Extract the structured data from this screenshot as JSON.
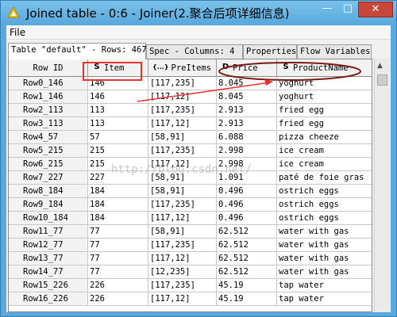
{
  "window": {
    "title": "Joined table - 0:6 - Joiner(2.聚合后项详细信息)"
  },
  "window_controls": {
    "minimize": "—",
    "maximize": "□",
    "close": "✕"
  },
  "menu": {
    "file": "File"
  },
  "tabs": [
    {
      "label": "Table \"default\" - Rows: 467",
      "active": true
    },
    {
      "label": "Spec - Columns: 4",
      "active": false
    },
    {
      "label": "Properties",
      "active": false
    },
    {
      "label": "Flow Variables",
      "active": false
    }
  ],
  "columns": [
    {
      "type_badge": "",
      "label": "Row ID"
    },
    {
      "type_badge": "S",
      "label": "Item"
    },
    {
      "type_badge": "{...}",
      "label": "PreItems"
    },
    {
      "type_badge": "D",
      "label": "Price"
    },
    {
      "type_badge": "S",
      "label": "ProductName"
    }
  ],
  "rows": [
    [
      "Row0_146",
      "146",
      "[117,235]",
      "8.045",
      "yoghurt"
    ],
    [
      "Row1_146",
      "146",
      "[117,12]",
      "8.045",
      "yoghurt"
    ],
    [
      "Row2_113",
      "113",
      "[117,235]",
      "2.913",
      "fried egg"
    ],
    [
      "Row3_113",
      "113",
      "[117,12]",
      "2.913",
      "fried egg"
    ],
    [
      "Row4_57",
      "57",
      "[58,91]",
      "6.088",
      "pizza cheeze"
    ],
    [
      "Row5_215",
      "215",
      "[117,235]",
      "2.998",
      "ice cream"
    ],
    [
      "Row6_215",
      "215",
      "[117,12]",
      "2.998",
      "ice cream"
    ],
    [
      "Row7_227",
      "227",
      "[58,91]",
      "1.091",
      "paté de foie gras"
    ],
    [
      "Row8_184",
      "184",
      "[58,91]",
      "0.496",
      "ostrich eggs"
    ],
    [
      "Row9_184",
      "184",
      "[117,235]",
      "0.496",
      "ostrich eggs"
    ],
    [
      "Row10_184",
      "184",
      "[117,12]",
      "0.496",
      "ostrich eggs"
    ],
    [
      "Row11_77",
      "77",
      "[58,91]",
      "62.512",
      "water with gas"
    ],
    [
      "Row12_77",
      "77",
      "[117,235]",
      "62.512",
      "water with gas"
    ],
    [
      "Row13_77",
      "77",
      "[117,12]",
      "62.512",
      "water with gas"
    ],
    [
      "Row14_77",
      "77",
      "[12,235]",
      "62.512",
      "water with gas"
    ],
    [
      "Row15_226",
      "226",
      "[117,235]",
      "45.19",
      "tap water"
    ],
    [
      "Row16_226",
      "226",
      "[117,12]",
      "45.19",
      "tap water"
    ]
  ],
  "watermark": "http://blog.csdn.net/",
  "colors": {
    "highlight_box": "#e8322e",
    "ellipse": "#7a1a10",
    "arrow": "#e8322e",
    "title_bar": "#5aa9d8"
  }
}
